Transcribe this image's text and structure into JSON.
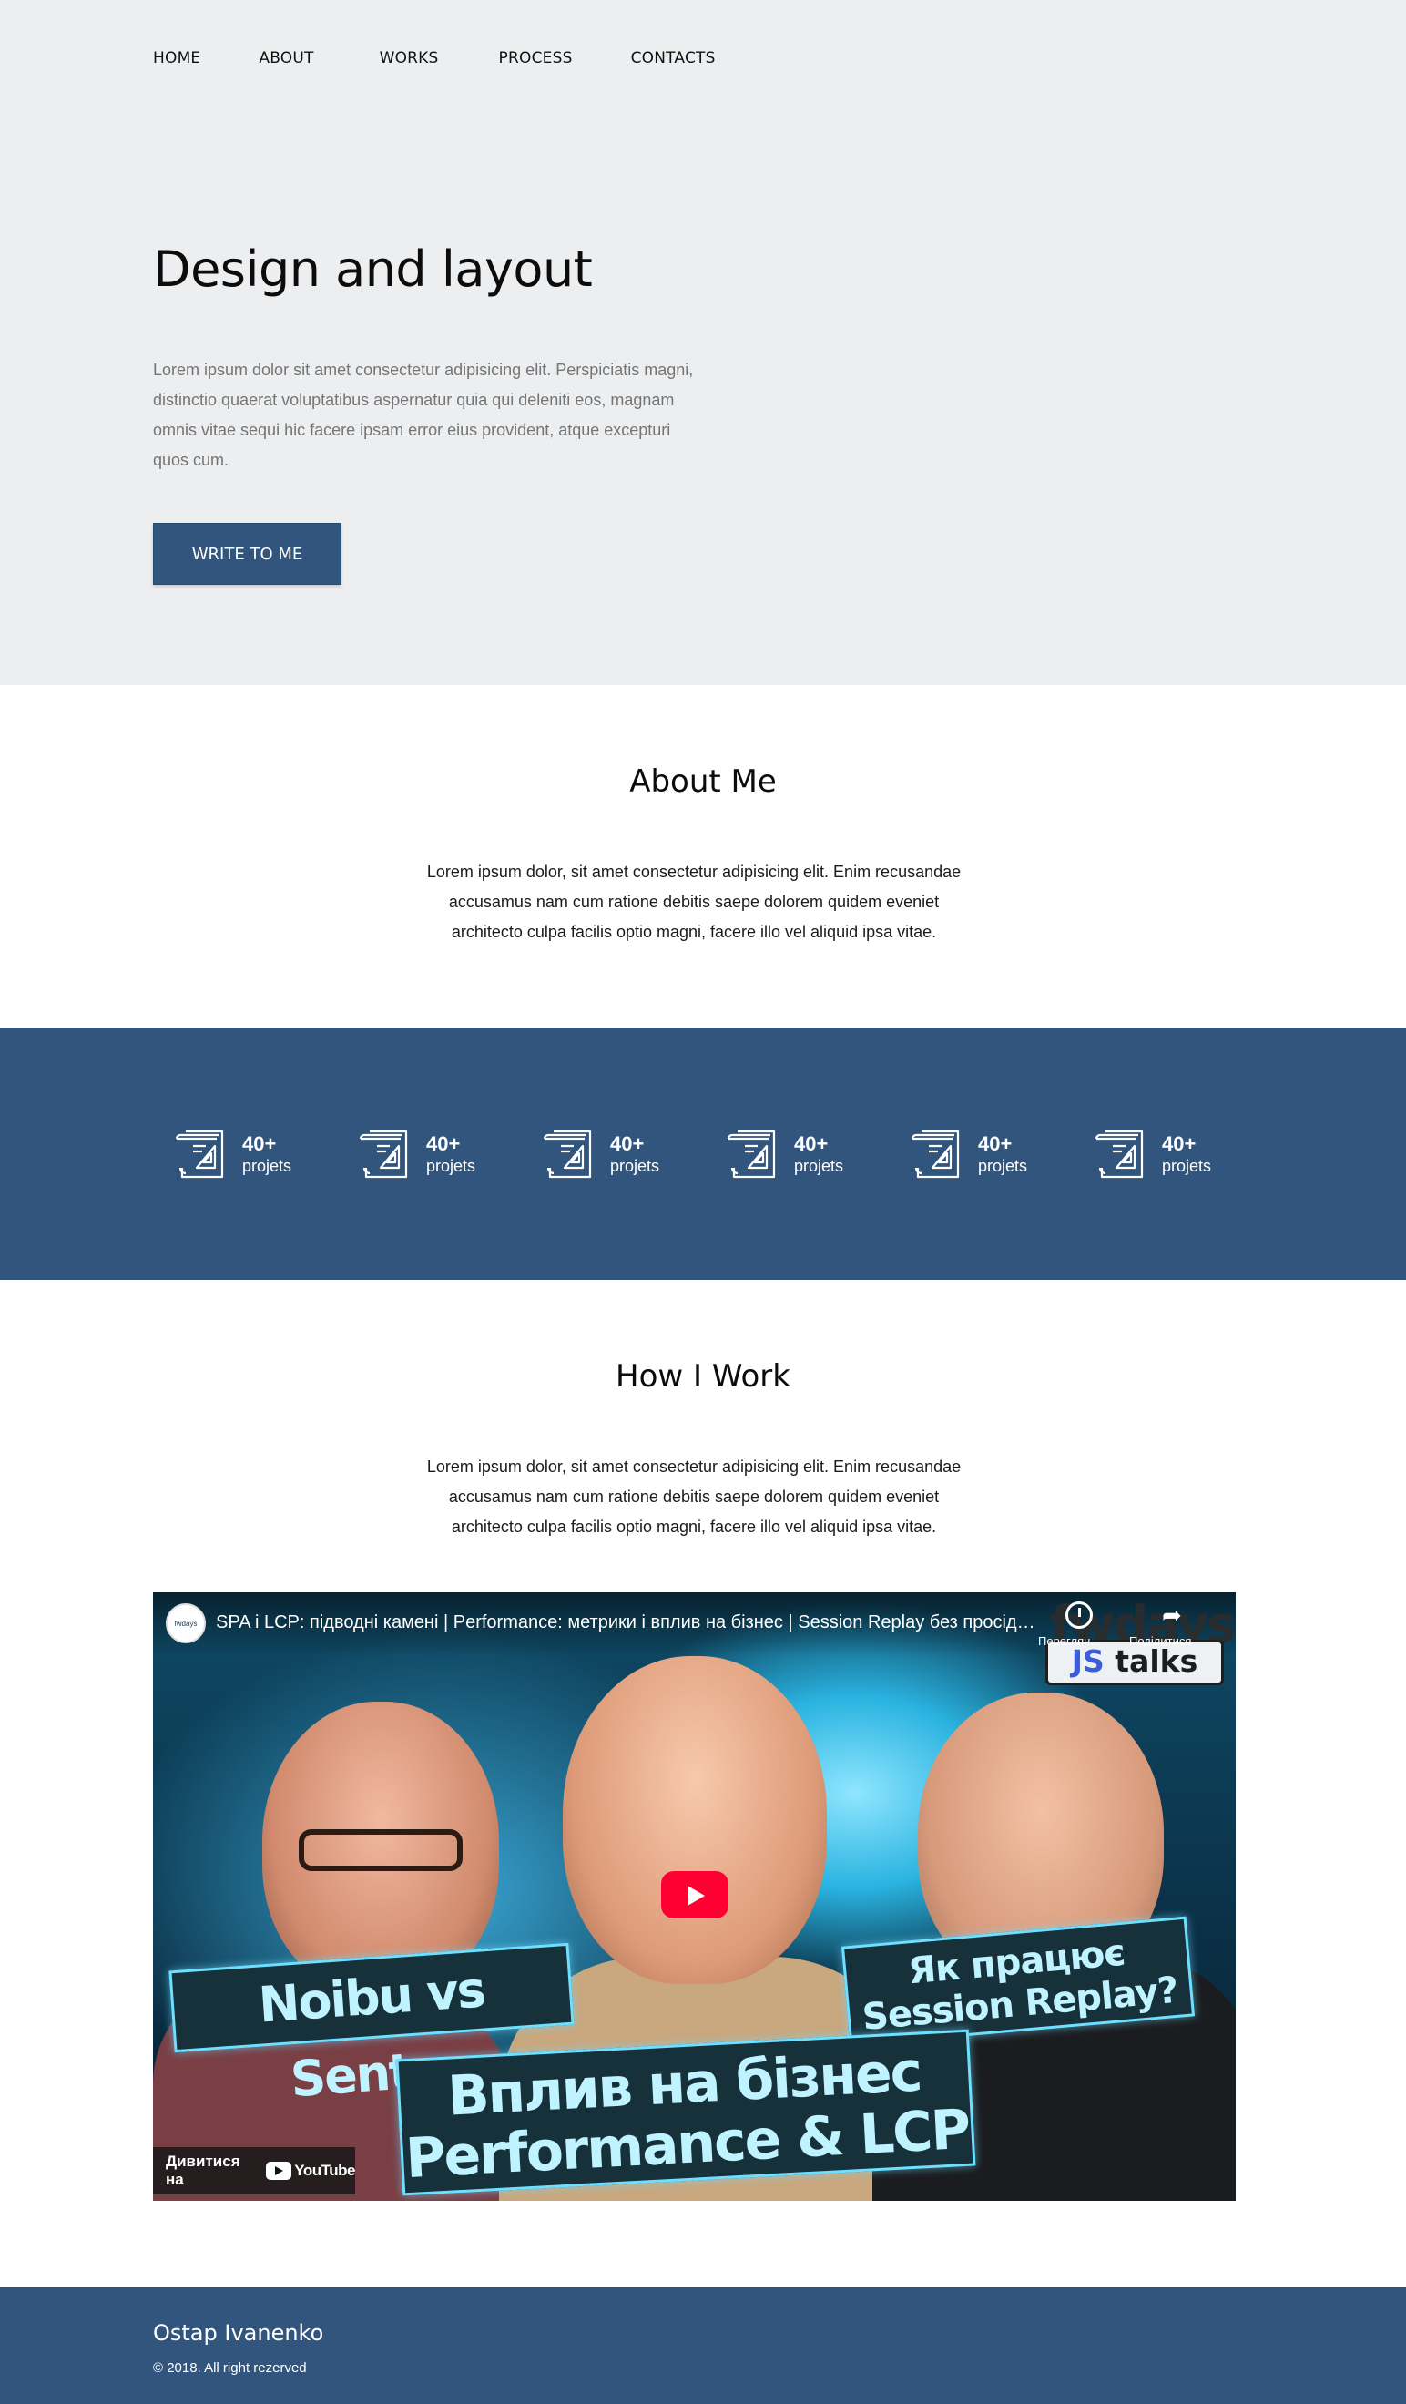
{
  "nav": {
    "items": [
      "HOME",
      "ABOUT",
      "WORKS",
      "PROCESS",
      "CONTACTS"
    ]
  },
  "hero": {
    "title": "Design and layout",
    "text": "Lorem ipsum dolor sit amet consectetur adipisicing elit. Perspiciatis magni, distinctio quaerat voluptatibus aspernatur quia qui deleniti eos, magnam omnis vitae sequi hic facere ipsam error eius provident, atque excepturi quos cum.",
    "button_label": "WRITE TO ME"
  },
  "about": {
    "title": "About Me",
    "text": "Lorem ipsum dolor, sit amet consectetur adipisicing elit. Enim recusandae accusamus nam cum ratione debitis saepe dolorem quidem eveniet architecto culpa facilis optio magni, facere illo vel aliquid ipsa vitae."
  },
  "stats": {
    "icon": "drafting-document-icon",
    "items": [
      {
        "value": "40+",
        "label": "projets"
      },
      {
        "value": "40+",
        "label": "projets"
      },
      {
        "value": "40+",
        "label": "projets"
      },
      {
        "value": "40+",
        "label": "projets"
      },
      {
        "value": "40+",
        "label": "projets"
      },
      {
        "value": "40+",
        "label": "projets"
      }
    ]
  },
  "how": {
    "title": "How I Work",
    "text": "Lorem ipsum dolor, sit amet consectetur adipisicing elit. Enim recusandae accusamus nam cum ratione debitis saepe dolorem quidem eveniet architecto culpa facilis optio magni, facere illo vel aliquid ipsa vitae."
  },
  "video": {
    "title": "SPA і LCP: підводні камені | Performance: метрики і вплив на бізнес | Session Replay без просід…",
    "channel": "fwdays",
    "later_label": "Переглян...",
    "share_label": "Поділитися",
    "brand_top": "fwdays",
    "brand_js": "JS",
    "brand_talks": "talks",
    "banner_left": "Noibu vs Sentry",
    "banner_right_1": "Як працює",
    "banner_right_2": "Session Replay?",
    "banner_center_1": "Вплив на бізнес",
    "banner_center_2": "Performance & LCP",
    "watch_on": "Дивитися на",
    "youtube": "YouTube"
  },
  "footer": {
    "name": "Ostap Ivanenko",
    "copyright": "© 2018. All right rezerved"
  },
  "colors": {
    "accent": "#32557d",
    "hero_bg": "#edeef0",
    "play": "#ff0033"
  }
}
